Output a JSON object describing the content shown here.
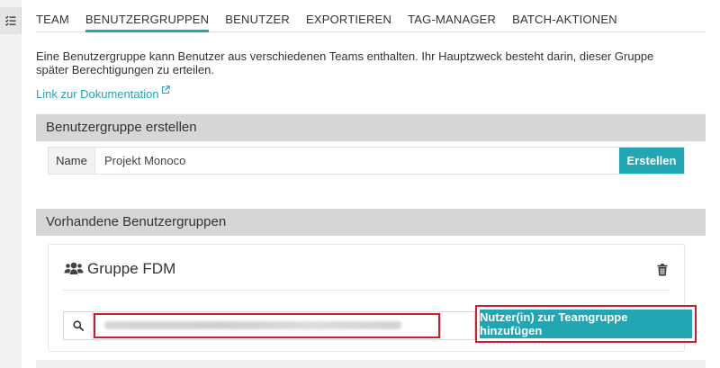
{
  "nav": {
    "tabs": [
      {
        "label": "TEAM",
        "active": false
      },
      {
        "label": "BENUTZERGRUPPEN",
        "active": true
      },
      {
        "label": "BENUTZER",
        "active": false
      },
      {
        "label": "EXPORTIEREN",
        "active": false
      },
      {
        "label": "TAG-MANAGER",
        "active": false
      },
      {
        "label": "BATCH-AKTIONEN",
        "active": false
      }
    ]
  },
  "intro": {
    "text": "Eine Benutzergruppe kann Benutzer aus verschiedenen Teams enthalten. Ihr Hauptzweck besteht darin, dieser Gruppe später Berechtigungen zu erteilen.",
    "doc_link": "Link zur Dokumentation"
  },
  "create": {
    "header": "Benutzergruppe erstellen",
    "name_label": "Name",
    "name_value": "Projekt Monoco",
    "button": "Erstellen"
  },
  "existing": {
    "header": "Vorhandene Benutzergruppen",
    "groups": [
      {
        "title": "Gruppe FDM",
        "add_button": "Nutzer(in) zur Teamgruppe hinzufügen"
      }
    ]
  },
  "colors": {
    "accent": "#22a6b3",
    "highlight": "#d11d2a"
  },
  "icons": {
    "sidebar_toggle": "list-check-icon",
    "external_link": "external-link-icon",
    "group": "users-icon",
    "delete": "trash-icon",
    "search": "search-icon"
  }
}
